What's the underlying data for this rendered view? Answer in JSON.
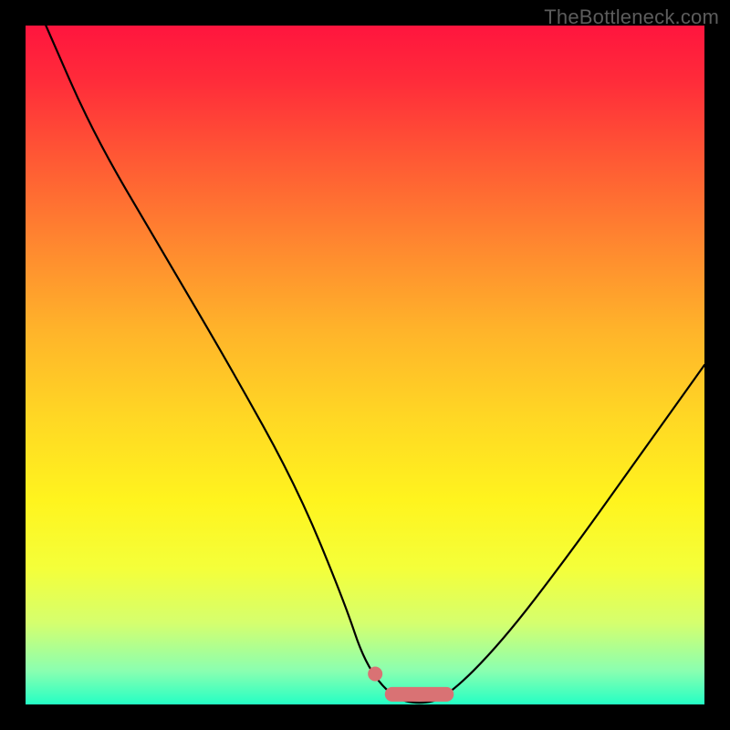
{
  "watermark": "TheBottleneck.com",
  "chart_data": {
    "type": "line",
    "title": "",
    "xlabel": "",
    "ylabel": "",
    "xlim": [
      0,
      100
    ],
    "ylim": [
      0,
      100
    ],
    "series": [
      {
        "name": "bottleneck-curve",
        "x": [
          3,
          10,
          20,
          30,
          40,
          47,
          50,
          54,
          58,
          62,
          70,
          80,
          90,
          100
        ],
        "values": [
          100,
          84,
          67,
          50,
          32,
          15,
          6,
          1,
          0,
          1,
          9,
          22,
          36,
          50
        ]
      }
    ],
    "markers": [
      {
        "name": "dot",
        "x": 51.5,
        "y": 4.5
      },
      {
        "name": "blob",
        "x_range": [
          54,
          62
        ],
        "y": 1.5
      }
    ],
    "colors": {
      "curve": "#000000",
      "marker": "#d97274",
      "gradient_top": "#ff153e",
      "gradient_bottom": "#24ffc4"
    }
  }
}
